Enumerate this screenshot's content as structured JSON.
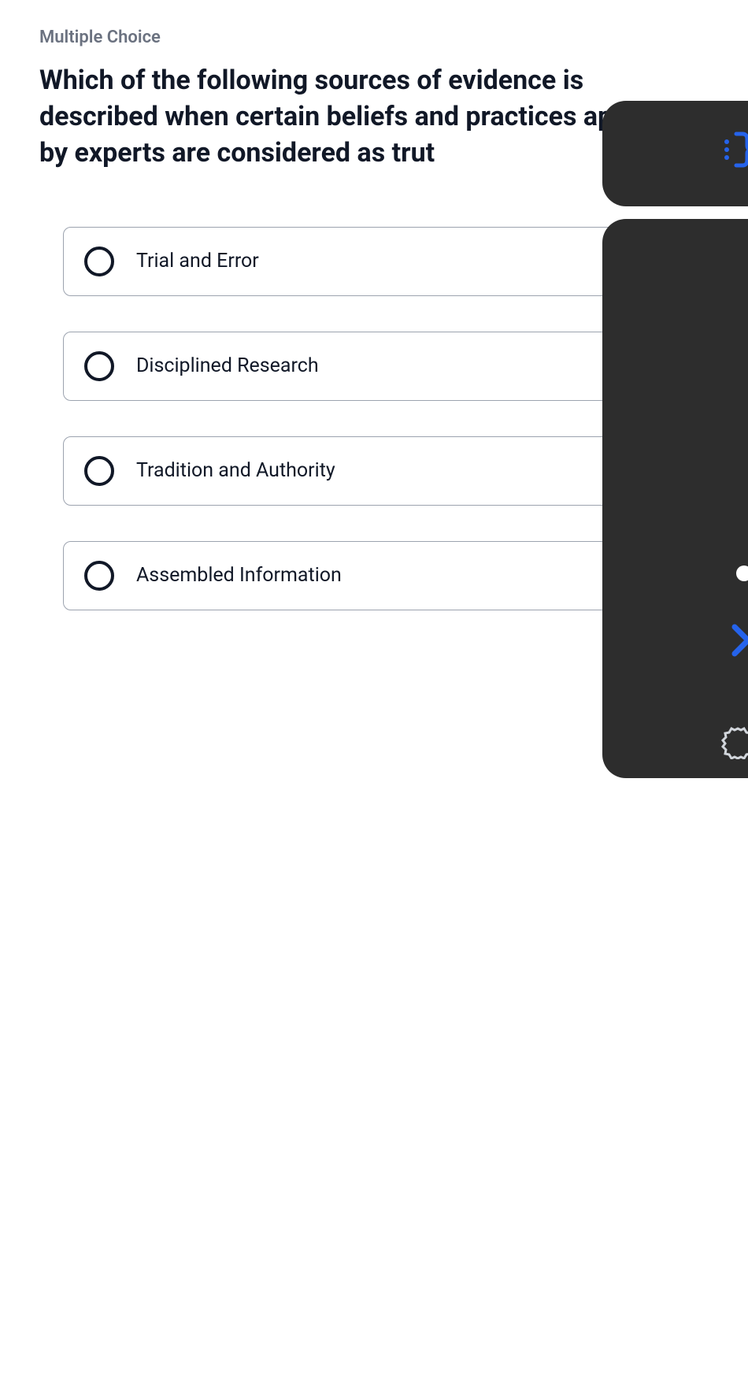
{
  "question_type": "Multiple Choice",
  "question_text": "Which of the following sources of evidence is described when certain beliefs and practices approved by experts are considered as trut",
  "options": [
    {
      "label": "Trial and Error"
    },
    {
      "label": "Disciplined Research"
    },
    {
      "label": "Tradition and Authority"
    },
    {
      "label": "Assembled Information"
    }
  ]
}
